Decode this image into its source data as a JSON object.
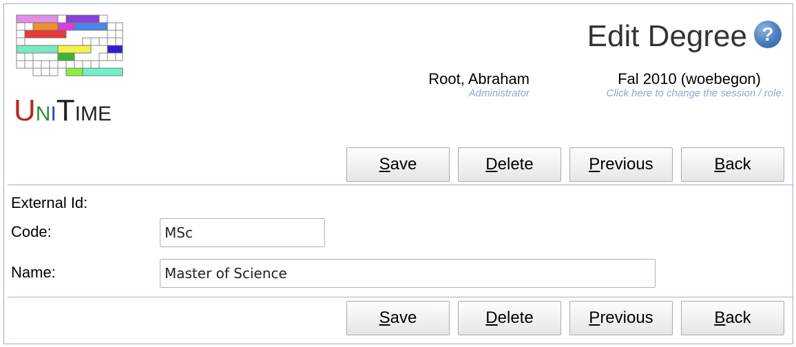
{
  "header": {
    "page_title": "Edit Degree",
    "help_icon": "?",
    "user": {
      "name": "Root, Abraham",
      "role": "Administrator"
    },
    "session": {
      "name": "Fal 2010 (woebegon)",
      "hint": "Click here to change the session / role."
    }
  },
  "logo": {
    "text": "UniTime",
    "parts": {
      "u": "U",
      "n": "N",
      "i": "I",
      "t": "T",
      "ime": "IME"
    },
    "colors": [
      "#e38ee8",
      "#8a3fd6",
      "#f0902f",
      "#e23ad8",
      "#4a86e8",
      "#e53935",
      "#7ae8c4",
      "#f5f24a",
      "#2e1dd1",
      "#3db33a",
      "#8ef03a",
      "#6ef0c8"
    ]
  },
  "buttons": {
    "save": {
      "key": "S",
      "rest": "ave"
    },
    "delete": {
      "key": "D",
      "rest": "elete"
    },
    "previous": {
      "key": "P",
      "rest": "revious"
    },
    "back": {
      "key": "B",
      "rest": "ack"
    }
  },
  "form": {
    "external_id": {
      "label": "External Id:",
      "value": ""
    },
    "code": {
      "label": "Code:",
      "value": "MSc"
    },
    "name": {
      "label": "Name:",
      "value": "Master of Science"
    }
  }
}
